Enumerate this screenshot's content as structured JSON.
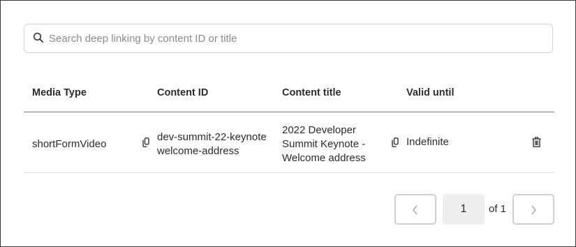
{
  "search": {
    "placeholder": "Search deep linking by content ID or title",
    "icon": "search-icon"
  },
  "table": {
    "columns": [
      "Media Type",
      "Content ID",
      "Content title",
      "Valid until"
    ],
    "rows": [
      {
        "media_type": "shortFormVideo",
        "content_id_lines": [
          "dev-summit-22-keynote",
          "welcome-address"
        ],
        "content_title_lines": [
          "2022 Developer",
          "Summit Keynote -",
          "Welcome address"
        ],
        "valid_until": "Indefinite",
        "icons": [
          "copy-icon",
          "copy-icon",
          "trash-icon"
        ]
      }
    ]
  },
  "pagination": {
    "current_page": "1",
    "of_label": "of 1",
    "icons": [
      "chevron-left-icon",
      "chevron-right-icon"
    ]
  },
  "colors": {
    "border": "#3a3a3a",
    "header_rule": "#7a7a7a",
    "row_rule": "#dcdcdc",
    "page_fill": "#eeeeee",
    "text": "#2b2b2b"
  }
}
